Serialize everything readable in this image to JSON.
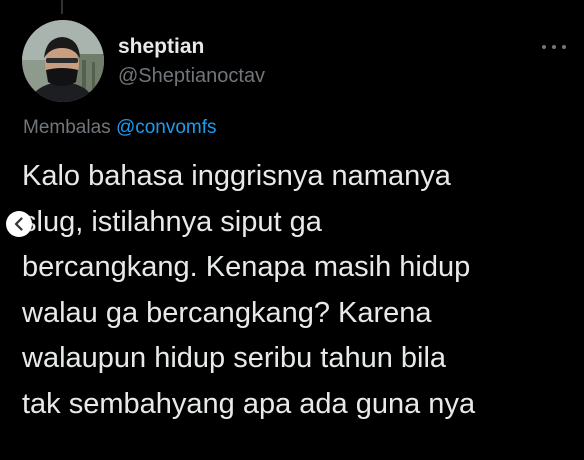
{
  "tweet": {
    "display_name": "sheptian",
    "handle": "@Sheptianoctav",
    "reply_prefix": "Membalas",
    "reply_mention": "@convomfs",
    "text": "Kalo bahasa inggrisnya namanya\nslug, istilahnya siput ga\nbercangkang. Kenapa masih hidup\nwalau ga bercangkang? Karena\nwalaupun hidup seribu tahun bila\ntak sembahyang apa ada guna nya"
  },
  "icons": {
    "more": "more-horizontal-icon",
    "back": "chevron-left-icon"
  },
  "colors": {
    "background": "#000000",
    "primary_text": "#e7e9ea",
    "secondary_text": "#71767b",
    "link": "#1d9bf0"
  }
}
